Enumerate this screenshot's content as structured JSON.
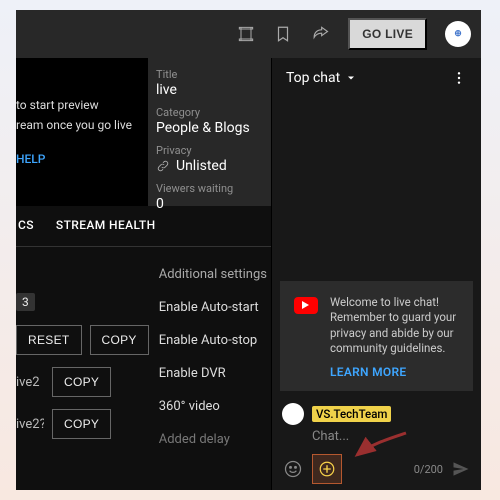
{
  "topbar": {
    "go_live": "GO LIVE"
  },
  "preview": {
    "line1": "to start preview",
    "line2": "ream once you go live",
    "help": "HELP"
  },
  "meta": {
    "title_label": "Title",
    "title_value": "live",
    "category_label": "Category",
    "category_value": "People & Blogs",
    "privacy_label": "Privacy",
    "privacy_value": "Unlisted",
    "viewers_label": "Viewers waiting",
    "viewers_value": "0"
  },
  "tabs": {
    "t1": "CS",
    "t2": "STREAM HEALTH"
  },
  "settings": {
    "badge": "3",
    "section_title": "Additional settings",
    "row1": "Enable Auto-start",
    "row2": "Enable Auto-stop",
    "row3": "Enable DVR",
    "row4": "360° video",
    "row5": "Added delay",
    "reset": "RESET",
    "copy": "COPY",
    "key_labels": [
      "ive2",
      "ive2?"
    ]
  },
  "chat": {
    "header": "Top chat",
    "notice": "Welcome to live chat! Remember to guard your privacy and abide by our community guidelines.",
    "learn_more": "LEARN MORE",
    "username": "VS.TechTeam",
    "placeholder": "Chat...",
    "counter": "0/200"
  }
}
